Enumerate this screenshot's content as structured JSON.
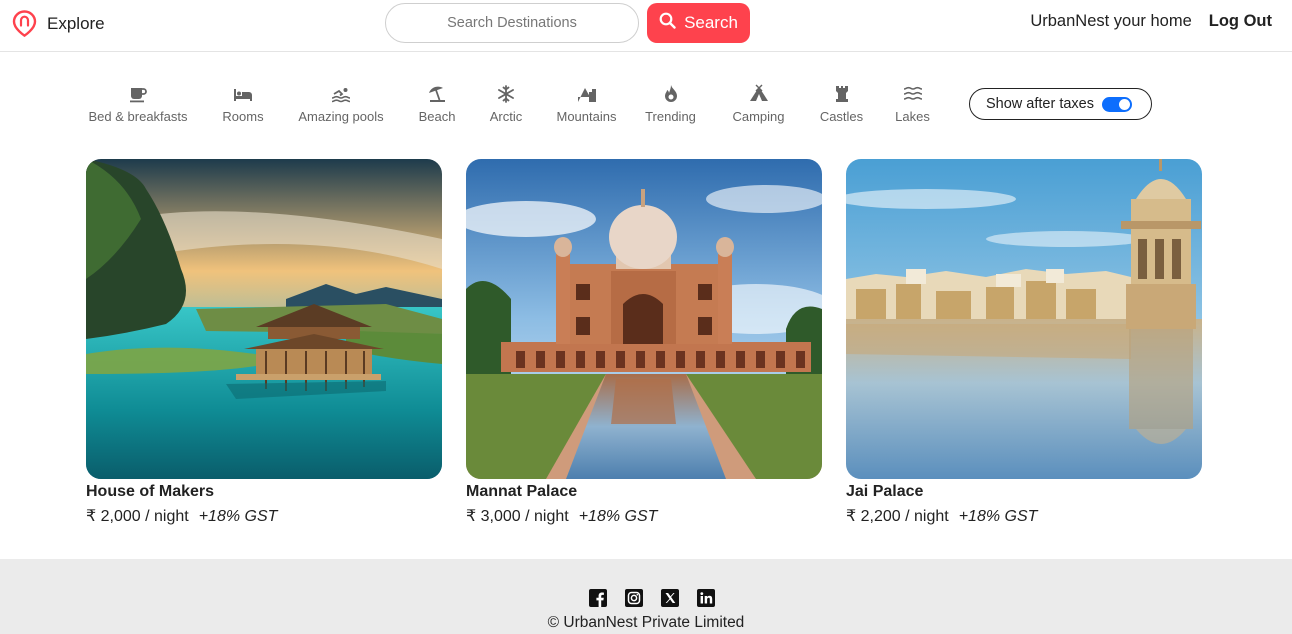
{
  "navbar": {
    "brand_label": "Explore",
    "search_placeholder": "Search Destinations",
    "search_button": "Search",
    "home_link": "UrbanNest your home",
    "logout": "Log Out",
    "accent": "#fe424d"
  },
  "filters": [
    {
      "label": "Bed & breakfasts",
      "icon": "mug-icon"
    },
    {
      "label": "Rooms",
      "icon": "bed-icon"
    },
    {
      "label": "Amazing pools",
      "icon": "swimmer-icon"
    },
    {
      "label": "Beach",
      "icon": "umbrella-beach-icon"
    },
    {
      "label": "Arctic",
      "icon": "snowflake-icon"
    },
    {
      "label": "Mountains",
      "icon": "mountain-city-icon"
    },
    {
      "label": "Trending",
      "icon": "fire-icon"
    },
    {
      "label": "Camping",
      "icon": "campground-icon"
    },
    {
      "label": "Castles",
      "icon": "chess-rook-icon"
    },
    {
      "label": "Lakes",
      "icon": "water-icon"
    }
  ],
  "tax_toggle": {
    "label": "Show after taxes",
    "checked": true
  },
  "listings": [
    {
      "title": "House of Makers",
      "price": "₹ 2,000 / night",
      "tax": "+18% GST"
    },
    {
      "title": "Mannat Palace",
      "price": "₹ 3,000 / night",
      "tax": "+18% GST"
    },
    {
      "title": "Jai Palace",
      "price": "₹ 2,200 / night",
      "tax": "+18% GST"
    }
  ],
  "footer": {
    "socials": [
      "facebook-icon",
      "instagram-icon",
      "x-twitter-icon",
      "linkedin-icon"
    ],
    "copyright": "© UrbanNest Private Limited"
  }
}
